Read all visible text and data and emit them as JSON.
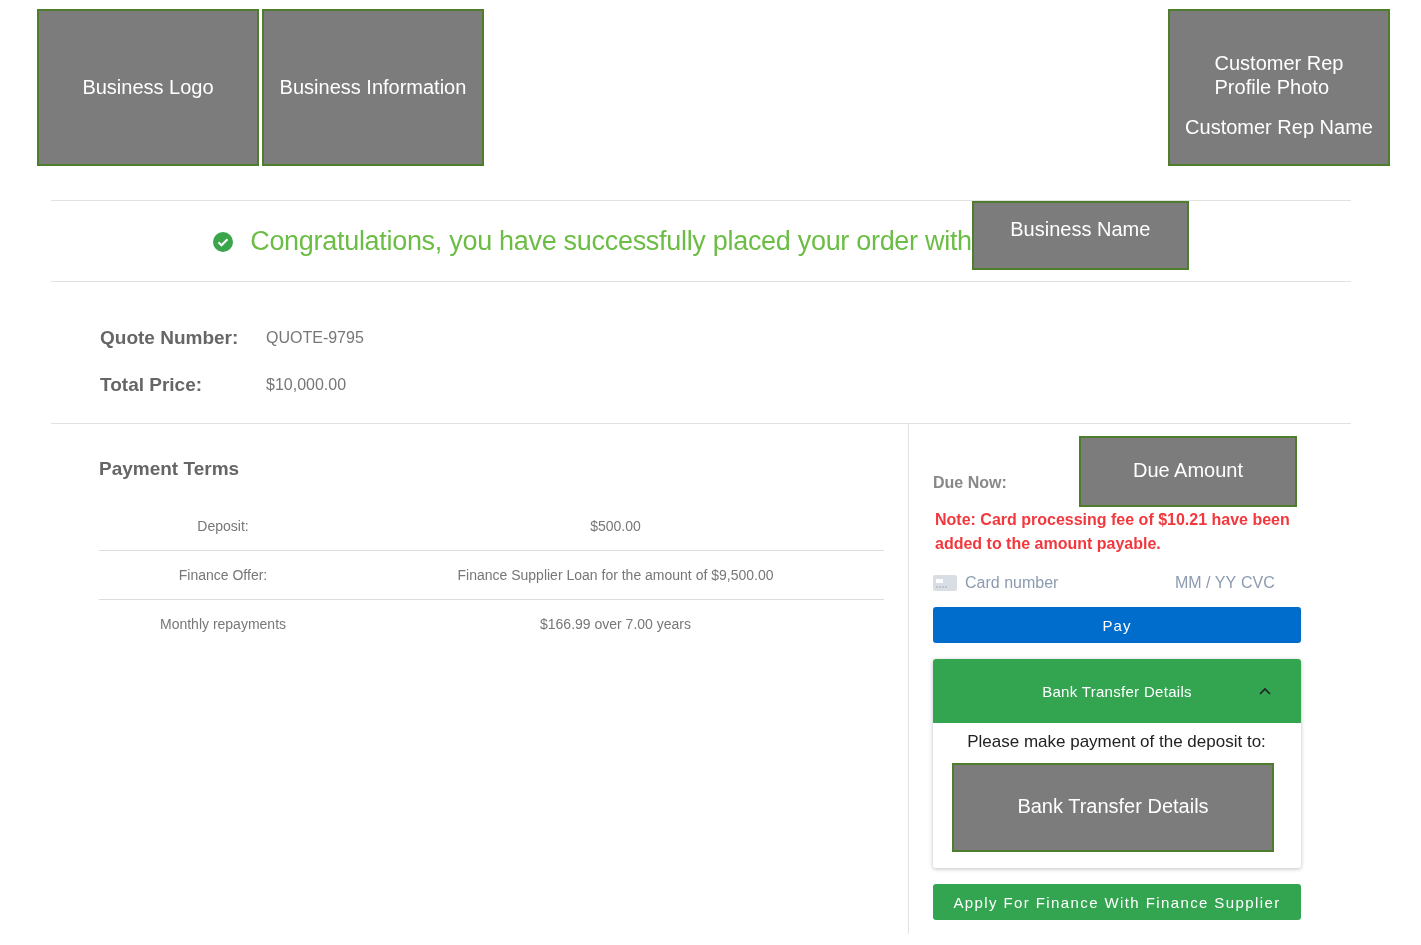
{
  "header": {
    "logo_overlay": {
      "label": "Business Logo"
    },
    "info_overlay": {
      "label": "Business Information"
    },
    "rep_overlay": {
      "labels": [
        "Customer Rep\nProfile Photo",
        "Customer Rep Name"
      ]
    }
  },
  "banner": {
    "message": "Congratulations, you have successfully placed your order with",
    "name_overlay": {
      "label": "Business Name"
    }
  },
  "summary": [
    {
      "label": "Quote Number:",
      "value": "QUOTE-9795"
    },
    {
      "label": "Total Price:",
      "value": "$10,000.00"
    }
  ],
  "payment_terms": {
    "title": "Payment Terms",
    "rows": [
      {
        "label": "Deposit:",
        "value": "$500.00"
      },
      {
        "label": "Finance Offer:",
        "value": "Finance Supplier Loan for the amount of $9,500.00"
      },
      {
        "label": "Monthly repayments",
        "value": "$166.99 over 7.00 years"
      }
    ]
  },
  "payment": {
    "due_label": "Due Now:",
    "due_overlay": {
      "label": "Due Amount"
    },
    "note": "Note: Card processing fee of $10.21 have been added to the amount payable.",
    "card": {
      "number_placeholder": "Card number",
      "expiry_placeholder": "MM / YY",
      "cvc_placeholder": "CVC"
    },
    "pay_button": "Pay",
    "bank": {
      "title": "Bank Transfer Details",
      "expanded": true,
      "intro": "Please make payment of the deposit to:",
      "details_overlay": {
        "label": "Bank Transfer Details"
      }
    },
    "finance_button": "Apply For Finance With Finance Supplier"
  }
}
